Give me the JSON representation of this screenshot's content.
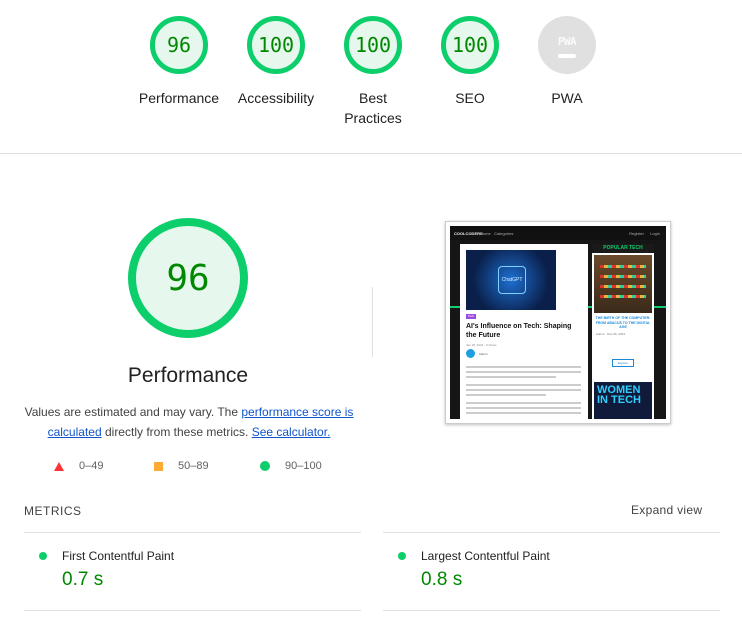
{
  "summary": {
    "categories": [
      {
        "label": "Performance",
        "score": "96"
      },
      {
        "label": "Accessibility",
        "score": "100"
      },
      {
        "label": "Best Practices",
        "score": "100"
      },
      {
        "label": "SEO",
        "score": "100"
      },
      {
        "label": "PWA",
        "score": "PWA"
      }
    ]
  },
  "performance": {
    "score": "96",
    "title": "Performance",
    "desc_prefix": "Values are estimated and may vary. The ",
    "desc_link1": "performance score is calculated",
    "desc_mid": " directly from these metrics. ",
    "desc_link2": "See calculator."
  },
  "legend": {
    "fail": "0–49",
    "average": "50–89",
    "pass": "90–100"
  },
  "screenshot": {
    "brand": "COOLCODERS",
    "nav_links": [
      "Home",
      "Categories"
    ],
    "nav_right": [
      "Register",
      "Login"
    ],
    "hero_label": "ChatGPT",
    "tag": "Tech",
    "article_title": "AI's Influence on Tech: Shaping the Future",
    "article_meta": "Jan 18, 2024 · 9 Views",
    "author": "Admin",
    "side_title": "POPULAR TECH",
    "side_heading": "THE BIRTH OF THE COMPUTER: FROM ABACUS TO THE DIGITAL AGE",
    "side_meta": "Admin · Dec 06, 2023",
    "side_button": "Explore",
    "women_text": "WOMEN IN TECH"
  },
  "metrics": {
    "heading": "METRICS",
    "expand_label": "Expand view",
    "items": [
      {
        "name": "First Contentful Paint",
        "value": "0.7 s"
      },
      {
        "name": "Largest Contentful Paint",
        "value": "0.8 s"
      }
    ]
  },
  "colors": {
    "pass": "#0cce6b",
    "average": "#ffaa33",
    "fail": "#ff3333",
    "pass_text": "#008800",
    "link": "#1155cc"
  }
}
